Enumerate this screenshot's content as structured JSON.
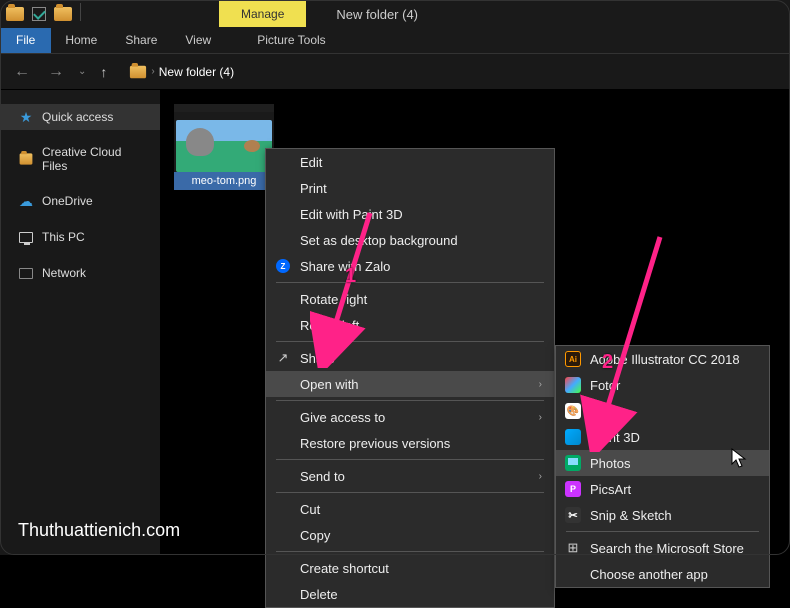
{
  "titlebar": {
    "contextual_tab": "Manage",
    "window_title": "New folder (4)"
  },
  "ribbon": {
    "file": "File",
    "tabs": [
      "Home",
      "Share",
      "View"
    ],
    "contextual": "Picture Tools"
  },
  "breadcrumb": {
    "path": "New folder (4)"
  },
  "sidebar": {
    "items": [
      {
        "label": "Quick access",
        "icon": "star"
      },
      {
        "label": "Creative Cloud Files",
        "icon": "ccf"
      },
      {
        "label": "OneDrive",
        "icon": "onedrive"
      },
      {
        "label": "This PC",
        "icon": "pc"
      },
      {
        "label": "Network",
        "icon": "network"
      }
    ]
  },
  "file": {
    "name": "meo-tom.png"
  },
  "context_menu": {
    "items": [
      {
        "label": "Edit"
      },
      {
        "label": "Print"
      },
      {
        "label": "Edit with Paint 3D"
      },
      {
        "label": "Set as desktop background"
      },
      {
        "label": "Share with Zalo",
        "icon": "zalo"
      },
      {
        "divider": true
      },
      {
        "label": "Rotate right"
      },
      {
        "label": "Rotate left"
      },
      {
        "divider": true
      },
      {
        "label": "Share",
        "icon": "share"
      },
      {
        "label": "Open with",
        "submenu": true,
        "highlighted": true
      },
      {
        "divider": true
      },
      {
        "label": "Give access to",
        "submenu": true
      },
      {
        "label": "Restore previous versions"
      },
      {
        "divider": true
      },
      {
        "label": "Send to",
        "submenu": true
      },
      {
        "divider": true
      },
      {
        "label": "Cut"
      },
      {
        "label": "Copy"
      },
      {
        "divider": true
      },
      {
        "label": "Create shortcut"
      },
      {
        "label": "Delete"
      }
    ]
  },
  "submenu": {
    "items": [
      {
        "label": "Adobe Illustrator CC 2018",
        "icon": "ai"
      },
      {
        "label": "Fotor",
        "icon": "fotor"
      },
      {
        "label": "Paint",
        "icon": "paint"
      },
      {
        "label": "Paint 3D",
        "icon": "paint3d"
      },
      {
        "label": "Photos",
        "icon": "photos",
        "highlighted": true
      },
      {
        "label": "PicsArt",
        "icon": "picsart"
      },
      {
        "label": "Snip & Sketch",
        "icon": "snip"
      },
      {
        "divider": true
      },
      {
        "label": "Search the Microsoft Store",
        "icon": "store"
      },
      {
        "label": "Choose another app"
      }
    ]
  },
  "annotations": {
    "num1": "1",
    "num2": "2"
  },
  "watermark": "Thuthuattienich.com"
}
